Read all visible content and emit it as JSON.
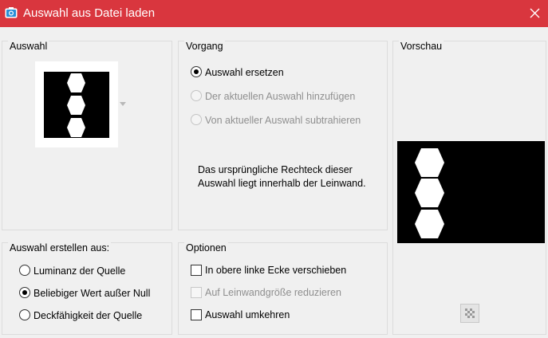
{
  "window": {
    "title": "Auswahl aus Datei laden"
  },
  "auswahl": {
    "label": "Auswahl"
  },
  "vorgang": {
    "label": "Vorgang",
    "options": [
      {
        "label": "Auswahl ersetzen",
        "checked": true,
        "enabled": true
      },
      {
        "label": "Der aktuellen Auswahl hinzufügen",
        "checked": false,
        "enabled": false
      },
      {
        "label": "Von aktueller Auswahl subtrahieren",
        "checked": false,
        "enabled": false
      }
    ],
    "note": "Das ursprüngliche Rechteck dieser Auswahl liegt innerhalb der Leinwand."
  },
  "vorschau": {
    "label": "Vorschau"
  },
  "source": {
    "label": "Auswahl erstellen aus:",
    "options": [
      {
        "label": "Luminanz der Quelle",
        "checked": false
      },
      {
        "label": "Beliebiger Wert außer Null",
        "checked": true
      },
      {
        "label": "Deckfähigkeit der Quelle",
        "checked": false
      }
    ]
  },
  "optionen": {
    "label": "Optionen",
    "checks": [
      {
        "label": "In obere linke Ecke verschieben",
        "checked": false,
        "enabled": true
      },
      {
        "label": "Auf Leinwandgröße reduzieren",
        "checked": false,
        "enabled": false
      },
      {
        "label": "Auswahl umkehren",
        "checked": false,
        "enabled": true
      }
    ]
  },
  "colors": {
    "titlebar": "#d9363e",
    "accent": "#0078d7"
  }
}
